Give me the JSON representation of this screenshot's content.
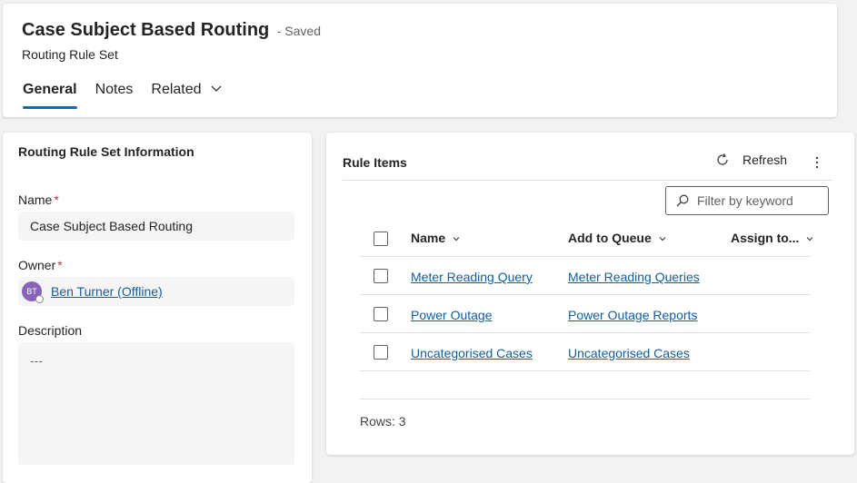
{
  "header": {
    "title": "Case Subject Based Routing",
    "saved_status": "- Saved",
    "subtitle": "Routing Rule Set",
    "tabs": [
      {
        "label": "General",
        "active": true
      },
      {
        "label": "Notes",
        "active": false
      },
      {
        "label": "Related",
        "active": false
      }
    ]
  },
  "info": {
    "section_title": "Routing Rule Set Information",
    "name_label": "Name",
    "name_value": "Case Subject Based Routing",
    "owner_label": "Owner",
    "owner_initials": "BT",
    "owner_value": "Ben Turner (Offline)",
    "description_label": "Description",
    "description_value": "---",
    "required_marker": "*"
  },
  "rules": {
    "title": "Rule Items",
    "refresh_label": "Refresh",
    "filter_placeholder": "Filter by keyword",
    "columns": [
      "Name",
      "Add to Queue",
      "Assign to..."
    ],
    "rows": [
      {
        "name": "Meter Reading Query",
        "queue": "Meter Reading Queries"
      },
      {
        "name": "Power Outage",
        "queue": "Power Outage Reports"
      },
      {
        "name": "Uncategorised Cases",
        "queue": "Uncategorised Cases"
      }
    ],
    "rows_count": "Rows: 3"
  },
  "colors": {
    "accent": "#0f6cbd",
    "link": "#115ea3",
    "required": "#c4314b",
    "avatar": "#8764b8"
  }
}
